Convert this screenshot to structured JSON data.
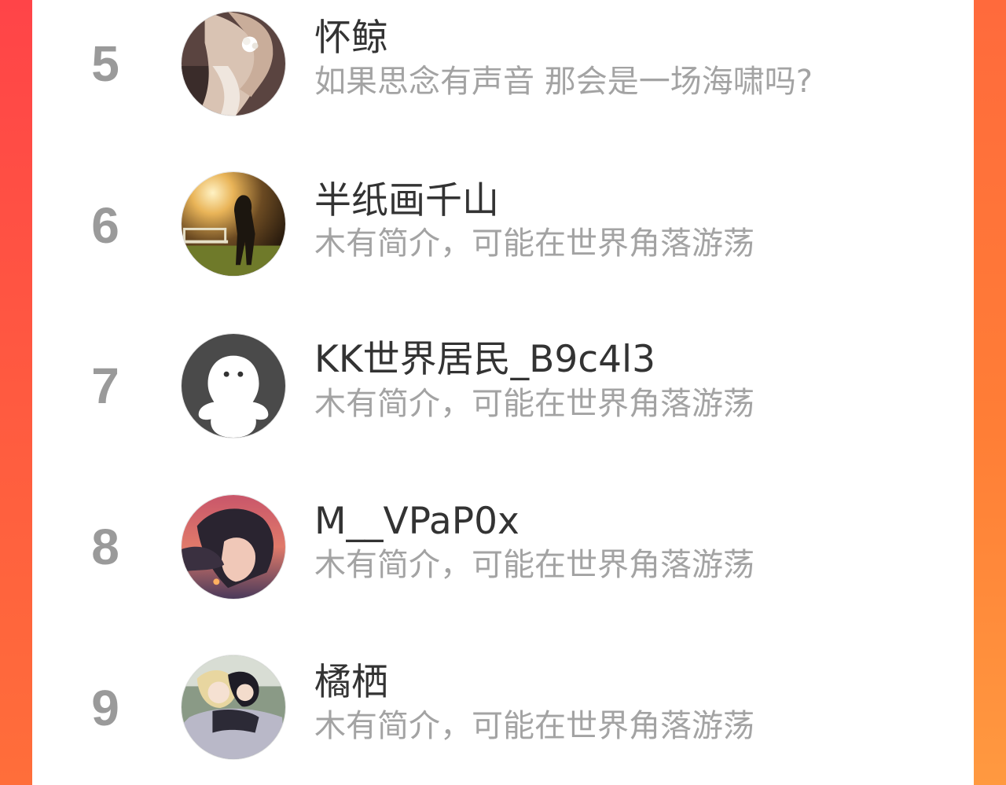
{
  "colors": {
    "accent_left": "#ff4448",
    "accent_right": "#ff8a33",
    "panel_bg": "#ffffff",
    "rank_color": "#9a9a9a",
    "name_color": "#333333",
    "bio_color": "#a3a3a3"
  },
  "rankings": [
    {
      "rank": "5",
      "name": "怀鲸",
      "bio": "如果思念有声音 那会是一场海啸吗?",
      "avatar_icon": "girl-hair-flower-avatar"
    },
    {
      "rank": "6",
      "name": "半纸画千山",
      "bio": "木有简介，可能在世界角落游荡",
      "avatar_icon": "stadium-sunset-avatar"
    },
    {
      "rank": "7",
      "name": "KK世界居民_B9c4l3",
      "bio": "木有简介，可能在世界角落游荡",
      "avatar_icon": "default-ghost-avatar"
    },
    {
      "rank": "8",
      "name": "M__VPaP0x",
      "bio": "木有简介，可能在世界角落游荡",
      "avatar_icon": "anime-portrait-avatar"
    },
    {
      "rank": "9",
      "name": "橘栖",
      "bio": "木有简介，可能在世界角落游荡",
      "avatar_icon": "anime-couple-avatar"
    }
  ]
}
